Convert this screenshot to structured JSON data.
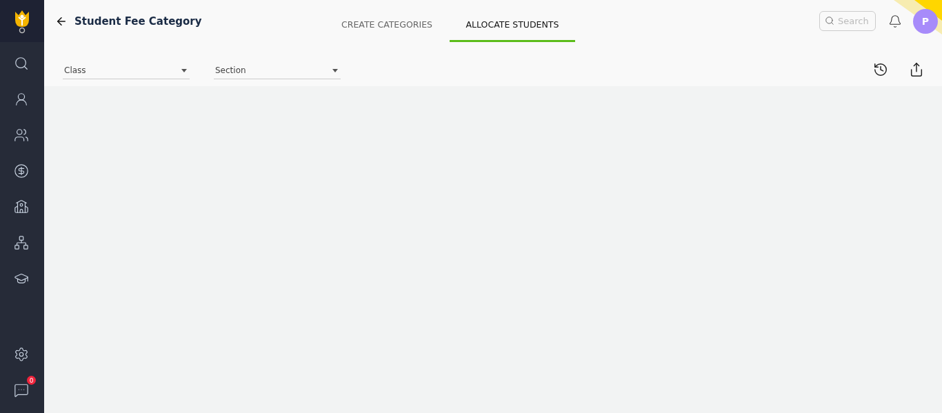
{
  "header": {
    "title": "Student Fee Category"
  },
  "tabs": [
    {
      "label": "CREATE CATEGORIES",
      "selected": false
    },
    {
      "label": "ALLOCATE STUDENTS",
      "selected": true
    }
  ],
  "search": {
    "placeholder": "Search"
  },
  "avatar": {
    "initial": "P"
  },
  "chat_badge": "0",
  "filters": [
    {
      "label": "Class"
    },
    {
      "label": "Section"
    }
  ]
}
